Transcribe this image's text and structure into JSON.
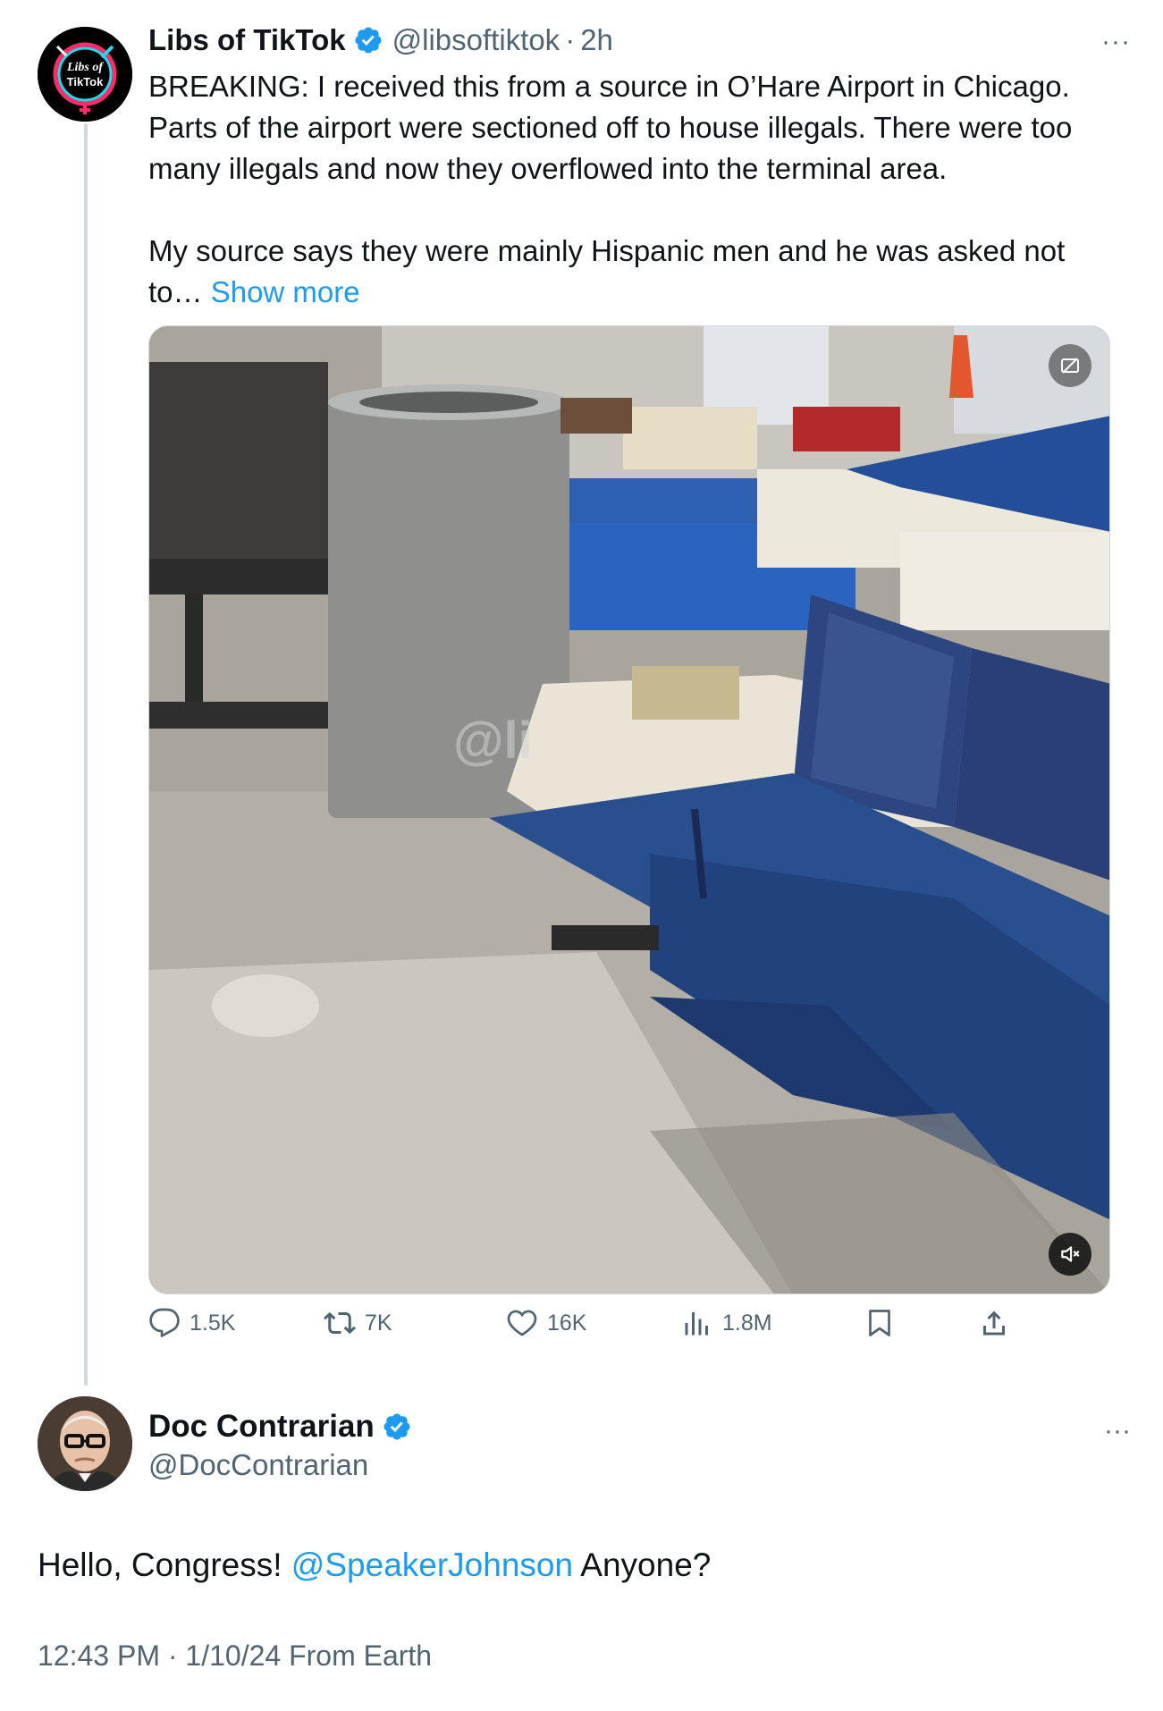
{
  "parent": {
    "avatar_text": [
      "Libs of",
      "TikTok"
    ],
    "name": "Libs of TikTok",
    "handle": "@libsoftiktok",
    "separator": "·",
    "time": "2h",
    "more": "···",
    "text": "BREAKING: I received this from a source in O’Hare Airport in Chicago. Parts of the airport were sectioned off to house illegals. There were too many illegals and now they overflowed into the terminal area.\n\nMy source says they were mainly Hispanic men and he was asked not to…",
    "show_more": "Show more",
    "media": {
      "watermark": "@li",
      "badge_icon": "sensitive-content-icon",
      "mute_icon": "muted-speaker-icon"
    },
    "actions": {
      "replies": "1.5K",
      "reposts": "7K",
      "likes": "16K",
      "views": "1.8M"
    }
  },
  "reply": {
    "name": "Doc Contrarian",
    "handle": "@DocContrarian",
    "more": "···",
    "text_before": "Hello, Congress! ",
    "mention": "@SpeakerJohnson",
    "text_after": " Anyone?",
    "timestamp": "12:43 PM · 1/10/24 From Earth"
  },
  "colors": {
    "link": "#1d9bf0",
    "secondary_text": "#536471",
    "verified": "#1d9bf0"
  }
}
